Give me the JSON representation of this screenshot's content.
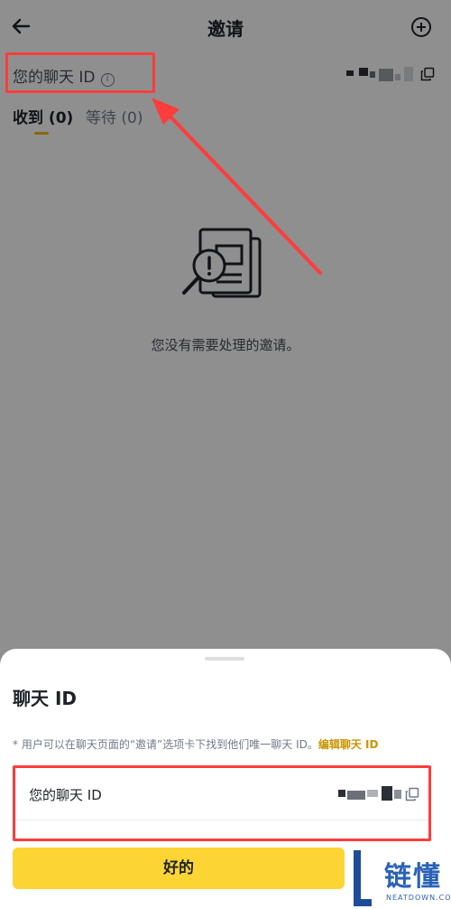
{
  "header": {
    "title": "邀请"
  },
  "chat_id_row": {
    "label": "您的聊天 ID",
    "info_glyph": "i"
  },
  "tabs": [
    {
      "label": "收到 (0)"
    },
    {
      "label": "等待 (0)"
    }
  ],
  "empty_state": {
    "text": "您没有需要处理的邀请。"
  },
  "sheet": {
    "title": "聊天 ID",
    "hint": "* 用户可以在聊天页面的“邀请”选项卡下找到他们唯一聊天 ID。",
    "hint_link": "编辑聊天 ID",
    "card_label": "您的聊天 ID",
    "ok_label": "好的"
  },
  "watermark": {
    "text": "链懂",
    "sub": "NEATDOWN.COM"
  },
  "colors": {
    "accent": "#fcd535",
    "link": "#c99400",
    "annotation_red": "#ff3c3c",
    "tab_indicator": "#f0b90b"
  },
  "icons": [
    "back-arrow-icon",
    "add-circle-icon",
    "info-icon",
    "copy-icon",
    "empty-document-search-icon"
  ]
}
